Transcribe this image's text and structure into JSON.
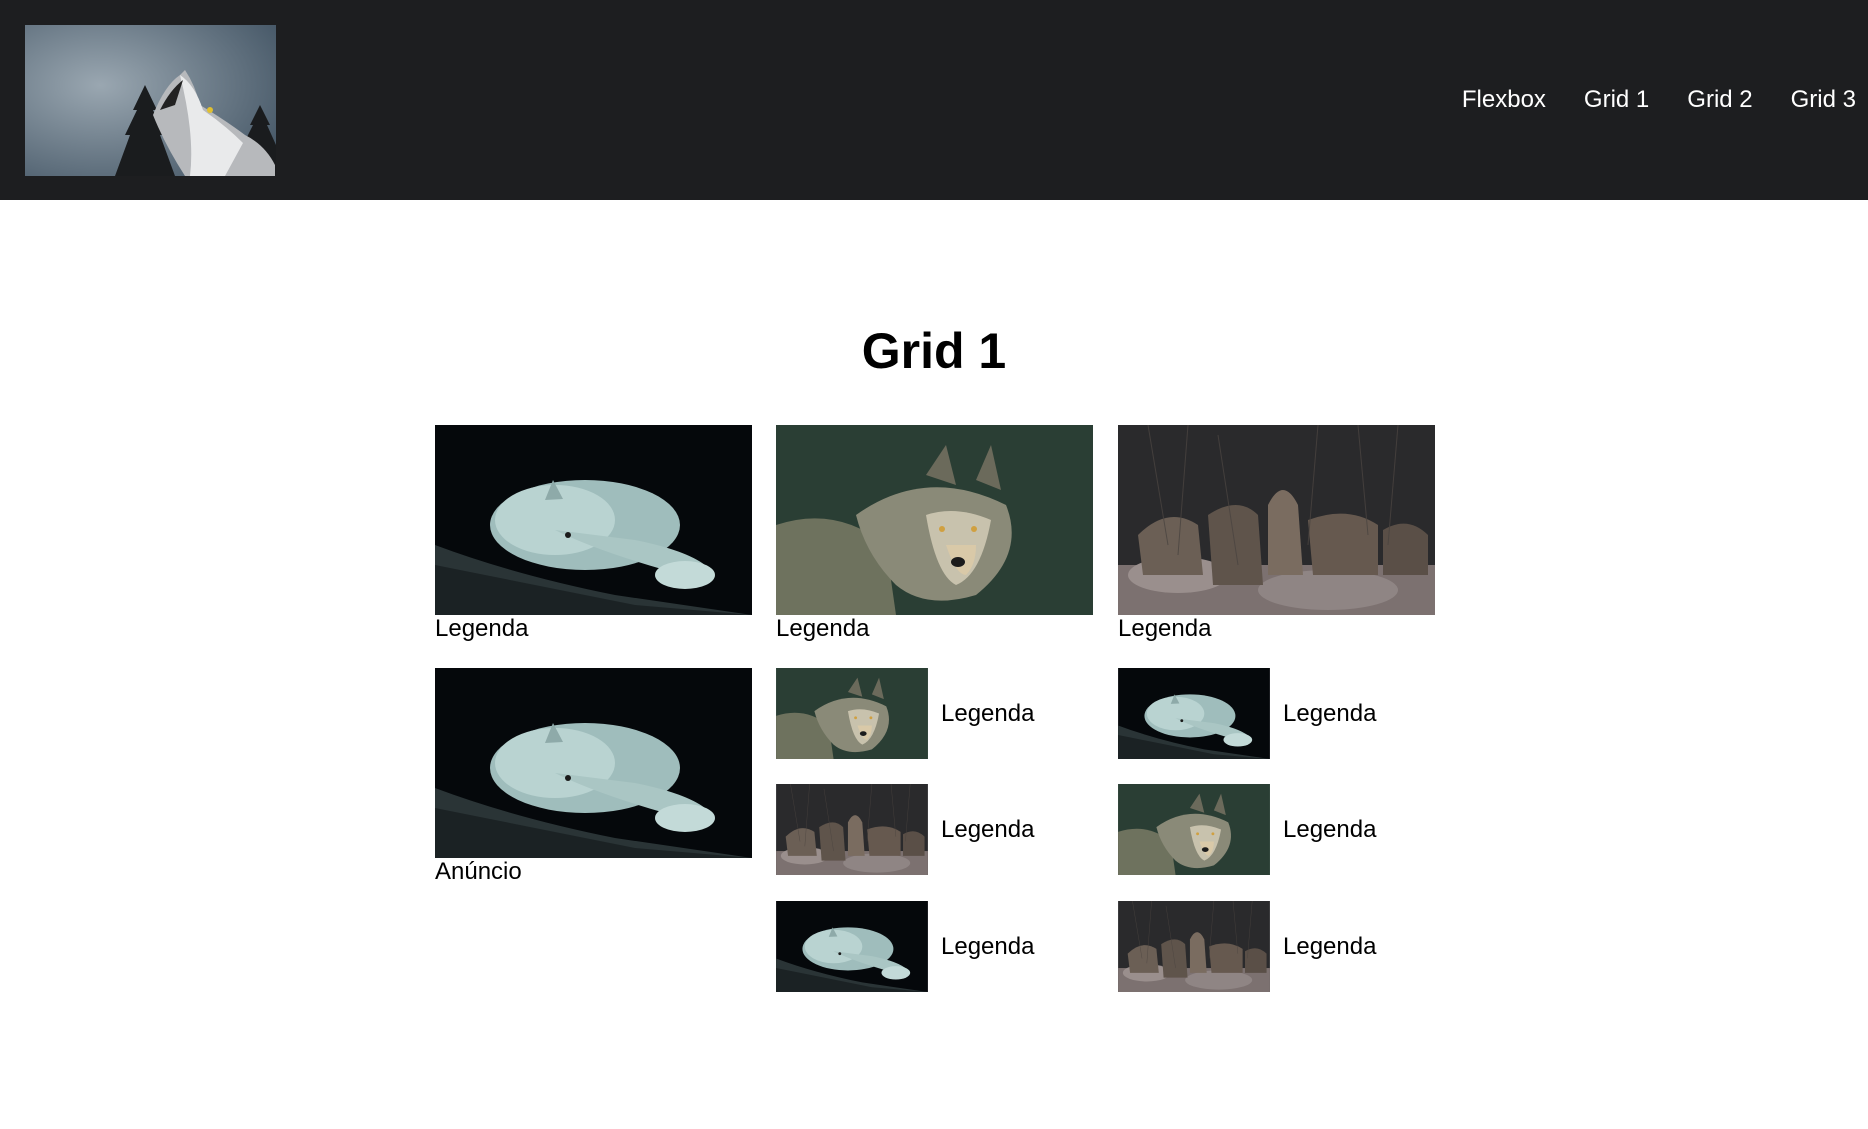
{
  "header": {
    "logo_icon": "howling-wolf-logo",
    "nav": [
      {
        "label": "Flexbox"
      },
      {
        "label": "Grid 1"
      },
      {
        "label": "Grid 2"
      },
      {
        "label": "Grid 3"
      }
    ]
  },
  "main": {
    "title": "Grid 1",
    "featured": [
      {
        "image": "white-wolf-resting",
        "caption": "Legenda"
      },
      {
        "image": "grey-wolf-portrait",
        "caption": "Legenda"
      },
      {
        "image": "wolf-pack-howling",
        "caption": "Legenda"
      }
    ],
    "ad": {
      "image": "white-wolf-resting",
      "caption": "Anúncio"
    },
    "list_col2": [
      {
        "image": "grey-wolf-portrait",
        "caption": "Legenda"
      },
      {
        "image": "wolf-pack-howling",
        "caption": "Legenda"
      },
      {
        "image": "white-wolf-resting",
        "caption": "Legenda"
      }
    ],
    "list_col3": [
      {
        "image": "white-wolf-resting",
        "caption": "Legenda"
      },
      {
        "image": "grey-wolf-portrait",
        "caption": "Legenda"
      },
      {
        "image": "wolf-pack-howling",
        "caption": "Legenda"
      }
    ]
  },
  "colors": {
    "header_bg": "#1d1e20",
    "nav_text": "#ffffff",
    "page_bg": "#ffffff"
  }
}
